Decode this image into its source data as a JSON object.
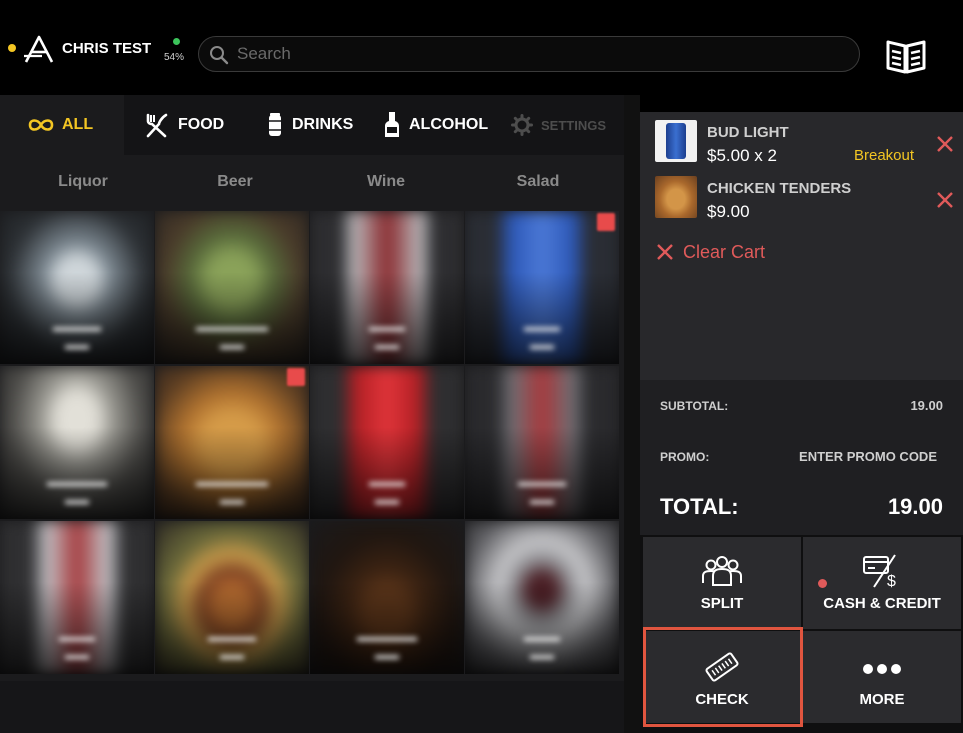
{
  "user": {
    "name": "CHRIS TEST",
    "battery": "54%"
  },
  "search": {
    "placeholder": "Search"
  },
  "categories": [
    {
      "label": "ALL",
      "icon": "infinity-icon"
    },
    {
      "label": "FOOD",
      "icon": "fork-knife-icon"
    },
    {
      "label": "DRINKS",
      "icon": "can-icon"
    },
    {
      "label": "ALCOHOL",
      "icon": "bottle-icon"
    },
    {
      "label": "SETTINGS",
      "icon": "gear-icon"
    }
  ],
  "subcategories": [
    "Liquor",
    "Beer",
    "Wine",
    "Salad"
  ],
  "cart": {
    "items": [
      {
        "name": "BUD LIGHT",
        "price": "$5.00 x 2",
        "action": "Breakout"
      },
      {
        "name": "CHICKEN TENDERS",
        "price": "$9.00"
      }
    ],
    "clear_label": "Clear Cart"
  },
  "totals": {
    "subtotal_label": "SUBTOTAL:",
    "subtotal_value": "19.00",
    "promo_label": "PROMO:",
    "promo_link": "ENTER PROMO CODE",
    "total_label": "TOTAL:",
    "total_value": "19.00"
  },
  "actions": {
    "split": "SPLIT",
    "cash_credit": "CASH & CREDIT",
    "check": "CHECK",
    "more": "MORE"
  },
  "colors": {
    "accent": "#f3c623",
    "danger": "#e05a5a",
    "panel": "#28282b",
    "highlight": "#e0553f"
  }
}
